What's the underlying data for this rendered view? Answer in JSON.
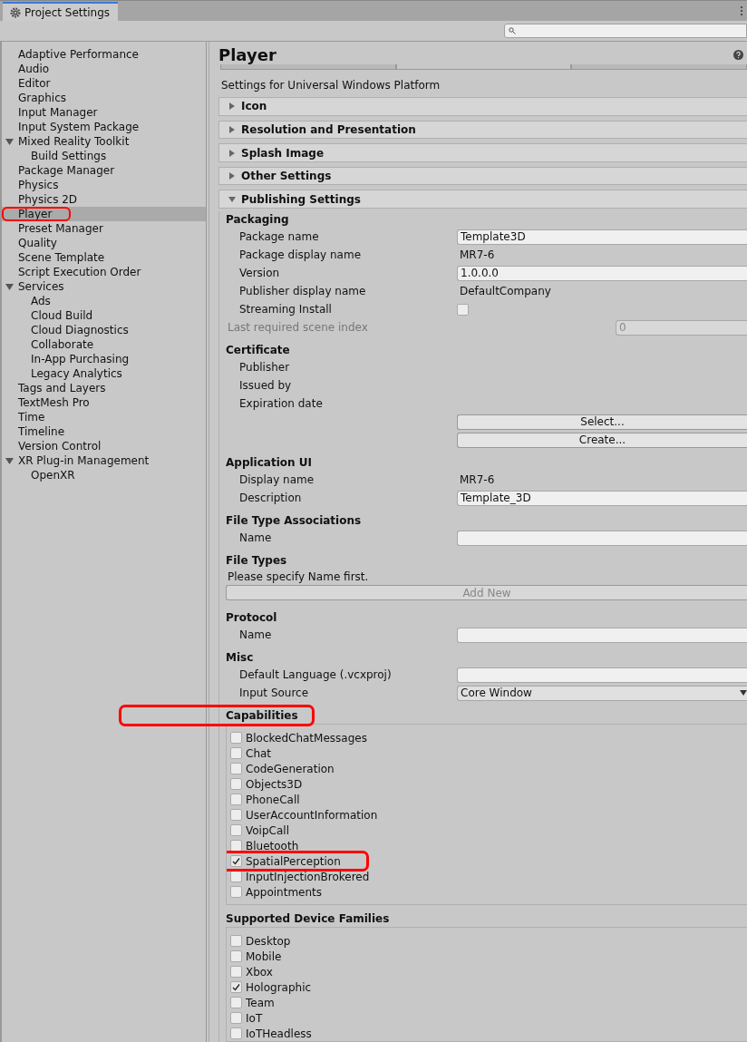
{
  "window": {
    "title": "Project Settings"
  },
  "sidebar": {
    "items": [
      {
        "label": "Adaptive Performance",
        "selected": false,
        "annotated": false
      },
      {
        "label": "Audio",
        "selected": false,
        "annotated": false
      },
      {
        "label": "Editor",
        "selected": false,
        "annotated": false
      },
      {
        "label": "Graphics",
        "selected": false,
        "annotated": false
      },
      {
        "label": "Input Manager",
        "selected": false,
        "annotated": false
      },
      {
        "label": "Input System Package",
        "selected": false,
        "annotated": false
      },
      {
        "label": "Mixed Reality Toolkit",
        "selected": false,
        "annotated": false,
        "expanded": true,
        "children": [
          {
            "label": "Build Settings",
            "selected": false,
            "annotated": false
          }
        ]
      },
      {
        "label": "Package Manager",
        "selected": false,
        "annotated": false
      },
      {
        "label": "Physics",
        "selected": false,
        "annotated": false
      },
      {
        "label": "Physics 2D",
        "selected": false,
        "annotated": false
      },
      {
        "label": "Player",
        "selected": true,
        "annotated": true
      },
      {
        "label": "Preset Manager",
        "selected": false,
        "annotated": false
      },
      {
        "label": "Quality",
        "selected": false,
        "annotated": false
      },
      {
        "label": "Scene Template",
        "selected": false,
        "annotated": false
      },
      {
        "label": "Script Execution Order",
        "selected": false,
        "annotated": false
      },
      {
        "label": "Services",
        "selected": false,
        "annotated": false,
        "expanded": true,
        "children": [
          {
            "label": "Ads",
            "selected": false,
            "annotated": false
          },
          {
            "label": "Cloud Build",
            "selected": false,
            "annotated": false
          },
          {
            "label": "Cloud Diagnostics",
            "selected": false,
            "annotated": false
          },
          {
            "label": "Collaborate",
            "selected": false,
            "annotated": false
          },
          {
            "label": "In-App Purchasing",
            "selected": false,
            "annotated": false
          },
          {
            "label": "Legacy Analytics",
            "selected": false,
            "annotated": false
          }
        ]
      },
      {
        "label": "Tags and Layers",
        "selected": false,
        "annotated": false
      },
      {
        "label": "TextMesh Pro",
        "selected": false,
        "annotated": false
      },
      {
        "label": "Time",
        "selected": false,
        "annotated": false
      },
      {
        "label": "Timeline",
        "selected": false,
        "annotated": false
      },
      {
        "label": "Version Control",
        "selected": false,
        "annotated": false
      },
      {
        "label": "XR Plug-in Management",
        "selected": false,
        "annotated": false,
        "expanded": true,
        "children": [
          {
            "label": "OpenXR",
            "selected": false,
            "annotated": false
          }
        ]
      }
    ]
  },
  "panel": {
    "title": "Player",
    "subtitle": "Settings for Universal Windows Platform",
    "platform_tabs": [
      {
        "selected": false
      },
      {
        "selected": true
      },
      {
        "selected": false
      }
    ],
    "foldouts": [
      {
        "label": "Icon",
        "expanded": false
      },
      {
        "label": "Resolution and Presentation",
        "expanded": false
      },
      {
        "label": "Splash Image",
        "expanded": false
      },
      {
        "label": "Other Settings",
        "expanded": false
      },
      {
        "label": "Publishing Settings",
        "expanded": true
      }
    ],
    "sections": [
      {
        "heading": "Packaging",
        "annotated": false,
        "rows": [
          {
            "kind": "input",
            "label": "Package name",
            "value": "Template3D"
          },
          {
            "kind": "text",
            "label": "Package display name",
            "value": "MR7-6"
          },
          {
            "kind": "input",
            "label": "Version",
            "value": "1.0.0.0"
          },
          {
            "kind": "text",
            "label": "Publisher display name",
            "value": "DefaultCompany"
          },
          {
            "kind": "checkbox",
            "label": "Streaming Install",
            "checked": false
          },
          {
            "kind": "number",
            "label": "Last required scene index",
            "value": "0",
            "disabled": true
          }
        ]
      },
      {
        "heading": "Certificate",
        "annotated": false,
        "rows": [
          {
            "kind": "label",
            "label": "Publisher"
          },
          {
            "kind": "label",
            "label": "Issued by"
          },
          {
            "kind": "label",
            "label": "Expiration date"
          },
          {
            "kind": "button",
            "label": "Select..."
          },
          {
            "kind": "button",
            "label": "Create..."
          }
        ]
      },
      {
        "heading": "Application UI",
        "annotated": false,
        "rows": [
          {
            "kind": "text",
            "label": "Display name",
            "value": "MR7-6"
          },
          {
            "kind": "input",
            "label": "Description",
            "value": "Template_3D"
          }
        ]
      },
      {
        "heading": "File Type Associations",
        "annotated": false,
        "rows": [
          {
            "kind": "input",
            "label": "Name"
          }
        ]
      },
      {
        "heading": "File Types",
        "annotated": false,
        "rows": [
          {
            "kind": "note",
            "label": "Please specify Name first."
          },
          {
            "kind": "wide_button",
            "label": "Add New",
            "disabled": true
          }
        ]
      },
      {
        "heading": "Protocol",
        "annotated": false,
        "rows": [
          {
            "kind": "input",
            "label": "Name"
          }
        ]
      },
      {
        "heading": "Misc",
        "annotated": false,
        "rows": [
          {
            "kind": "input",
            "label": "Default Language (.vcxproj)"
          },
          {
            "kind": "dropdown",
            "label": "Input Source",
            "value": "Core Window"
          }
        ]
      },
      {
        "heading": "Capabilities",
        "annotated": true,
        "rows": [
          {
            "kind": "checklist",
            "scroll": true,
            "items": [
              {
                "label": "BlockedChatMessages",
                "checked": false,
                "annotated": false
              },
              {
                "label": "Chat",
                "checked": false,
                "annotated": false
              },
              {
                "label": "CodeGeneration",
                "checked": false,
                "annotated": false
              },
              {
                "label": "Objects3D",
                "checked": false,
                "annotated": false
              },
              {
                "label": "PhoneCall",
                "checked": false,
                "annotated": false
              },
              {
                "label": "UserAccountInformation",
                "checked": false,
                "annotated": false
              },
              {
                "label": "VoipCall",
                "checked": false,
                "annotated": false
              },
              {
                "label": "Bluetooth",
                "checked": false,
                "annotated": false
              },
              {
                "label": "SpatialPerception",
                "checked": true,
                "annotated": true
              },
              {
                "label": "InputInjectionBrokered",
                "checked": false,
                "annotated": false
              },
              {
                "label": "Appointments",
                "checked": false,
                "annotated": false
              }
            ]
          }
        ]
      },
      {
        "heading": "Supported Device Families",
        "annotated": false,
        "rows": [
          {
            "kind": "checklist",
            "scroll": false,
            "items": [
              {
                "label": "Desktop",
                "checked": false,
                "annotated": false
              },
              {
                "label": "Mobile",
                "checked": false,
                "annotated": false
              },
              {
                "label": "Xbox",
                "checked": false,
                "annotated": false
              },
              {
                "label": "Holographic",
                "checked": true,
                "annotated": false
              },
              {
                "label": "Team",
                "checked": false,
                "annotated": false
              },
              {
                "label": "IoT",
                "checked": false,
                "annotated": false
              },
              {
                "label": "IoTHeadless",
                "checked": false,
                "annotated": false
              }
            ]
          }
        ]
      }
    ]
  }
}
